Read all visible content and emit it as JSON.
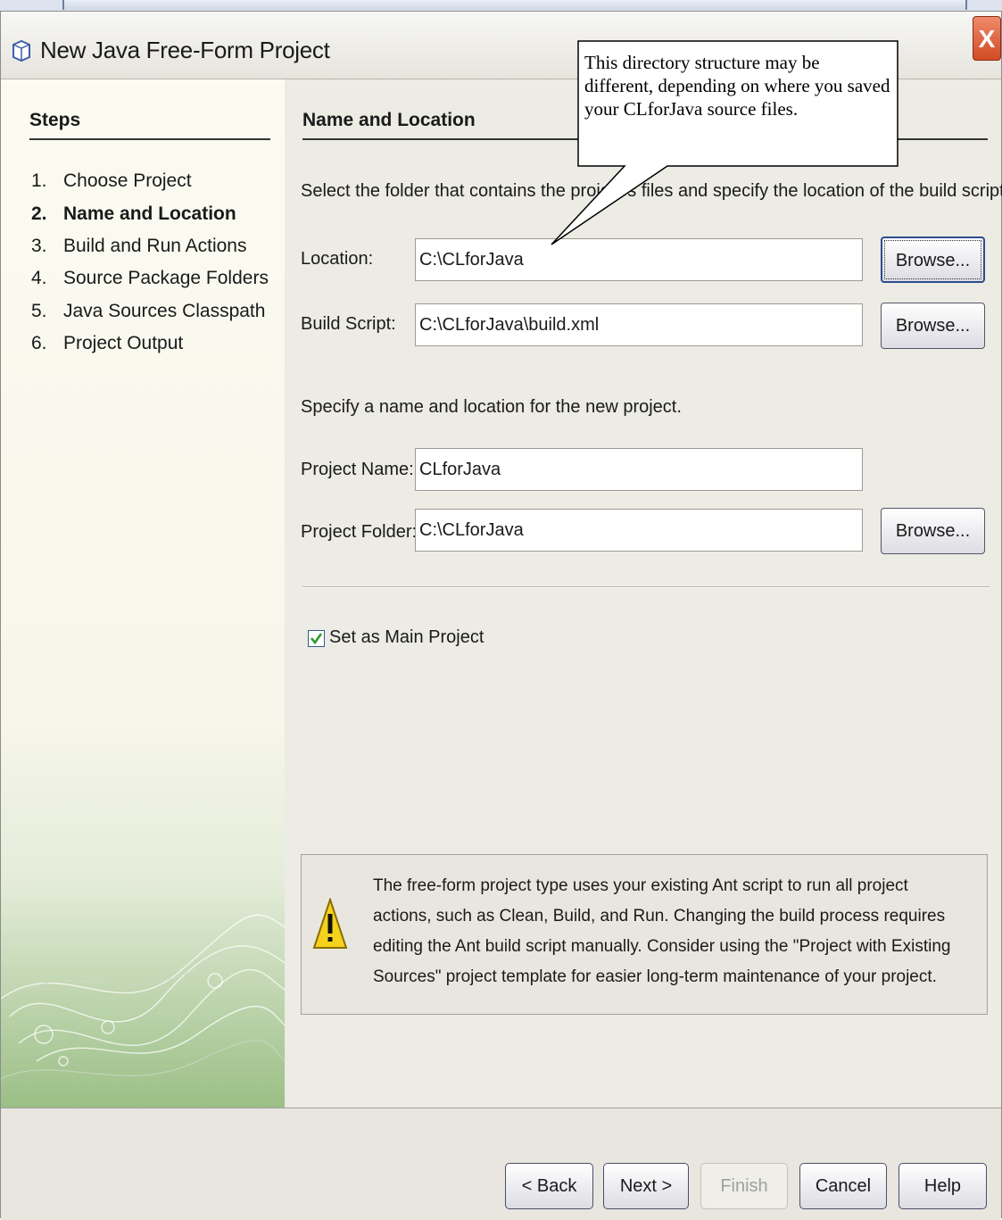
{
  "window": {
    "title": "New Java Free-Form Project",
    "close_glyph": "X"
  },
  "steps": {
    "title": "Steps",
    "items": [
      {
        "num": "1.",
        "label": "Choose Project"
      },
      {
        "num": "2.",
        "label": "Name and Location"
      },
      {
        "num": "3.",
        "label": "Build and Run Actions"
      },
      {
        "num": "4.",
        "label": "Source Package Folders"
      },
      {
        "num": "5.",
        "label": "Java Sources Classpath"
      },
      {
        "num": "6.",
        "label": "Project Output"
      }
    ],
    "active_index": 1
  },
  "main": {
    "section_title": "Name and Location",
    "instruction1": "Select the folder that contains the project's files and specify the location of the build script.",
    "location_label": "Location:",
    "location_value": "C:\\CLforJava",
    "build_script_label": "Build Script:",
    "build_script_value": "C:\\CLforJava\\build.xml",
    "instruction2": "Specify a name and location for the new project.",
    "project_name_label": "Project Name:",
    "project_name_value": "CLforJava",
    "project_folder_label": "Project Folder:",
    "project_folder_value": "C:\\CLforJava",
    "browse_label": "Browse...",
    "main_project_label": "Set as Main Project",
    "main_project_checked": true,
    "warning_text": "The free-form project type uses your existing Ant script to run all project actions, such as Clean, Build, and Run. Changing the build process requires editing the Ant build script manually. Consider using the \"Project with Existing Sources\" project template for easier long-term maintenance of your  project."
  },
  "buttons": {
    "back": "< Back",
    "next": "Next >",
    "finish": "Finish",
    "cancel": "Cancel",
    "help": "Help"
  },
  "callout": {
    "text": "This directory structure may be different, depending on where you saved your CLforJava source files."
  },
  "colors": {
    "close_button": "#d14b25",
    "check_mark": "#2e9a2e",
    "warning_yellow": "#f5d21c",
    "accent_border": "#2c4c8c"
  },
  "icons": {
    "title": "java-project-icon",
    "warning": "warning-icon",
    "checkbox": "checkmark-icon"
  }
}
